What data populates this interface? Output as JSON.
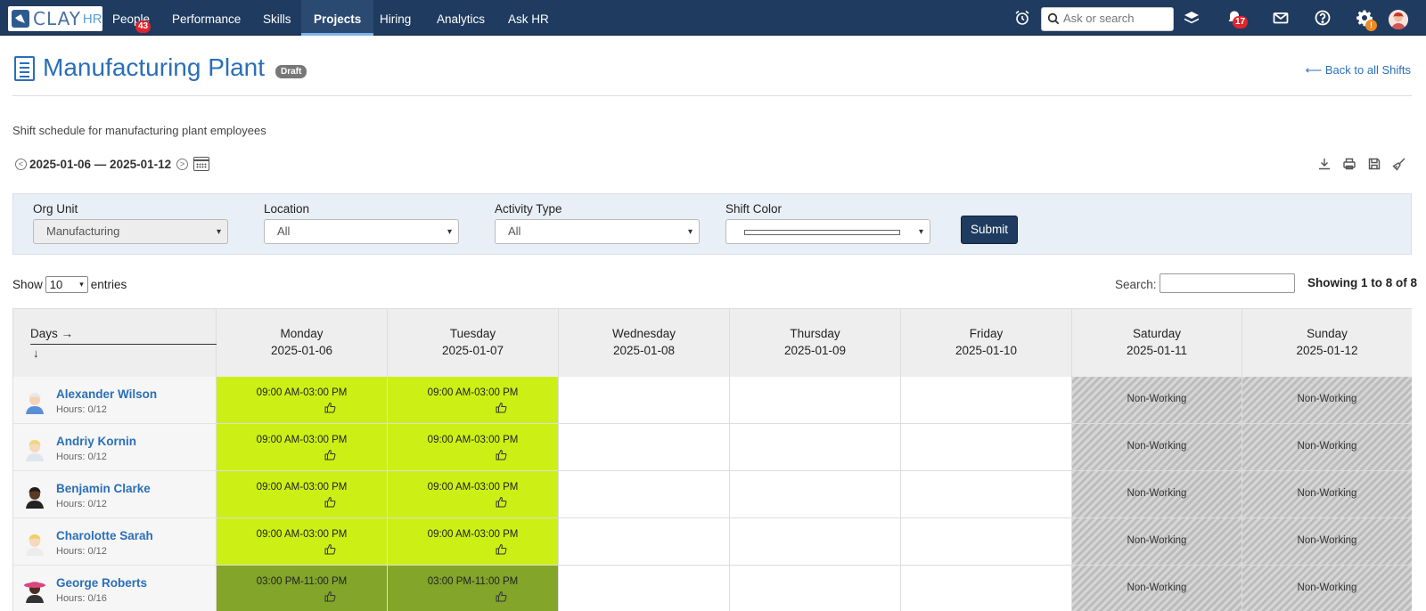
{
  "nav": {
    "logo_text": "CLAY",
    "logo_suffix": "HR",
    "items": [
      {
        "label": "People",
        "badge": "43"
      },
      {
        "label": "Performance"
      },
      {
        "label": "Skills"
      },
      {
        "label": "Projects",
        "active": true
      },
      {
        "label": "Hiring"
      },
      {
        "label": "Analytics"
      },
      {
        "label": "Ask HR"
      }
    ],
    "search_placeholder": "Ask or search",
    "notifications_badge": "17",
    "settings_badge": "!",
    "icons": [
      "alarm-clock-icon",
      "layers-icon",
      "bell-icon",
      "mail-icon",
      "help-icon",
      "gear-icon"
    ]
  },
  "header": {
    "title": "Manufacturing Plant",
    "status": "Draft",
    "back_link": "Back to all Shifts",
    "description": "Shift schedule for manufacturing plant employees",
    "date_range": "2025-01-06 — 2025-01-12"
  },
  "filters": {
    "org_unit": {
      "label": "Org Unit",
      "value": "Manufacturing"
    },
    "location": {
      "label": "Location",
      "value": "All"
    },
    "activity_type": {
      "label": "Activity Type",
      "value": "All"
    },
    "shift_color": {
      "label": "Shift Color",
      "value": ""
    },
    "submit": "Submit"
  },
  "table_controls": {
    "show_label": "Show",
    "show_value": "10",
    "entries_label": "entries",
    "search_label": "Search:",
    "showing": "Showing 1 to 8 of 8"
  },
  "schedule": {
    "days_header": "Days →",
    "down_arrow": "↓",
    "days": [
      {
        "name": "Monday",
        "date": "2025-01-06"
      },
      {
        "name": "Tuesday",
        "date": "2025-01-07"
      },
      {
        "name": "Wednesday",
        "date": "2025-01-08"
      },
      {
        "name": "Thursday",
        "date": "2025-01-09"
      },
      {
        "name": "Friday",
        "date": "2025-01-10"
      },
      {
        "name": "Saturday",
        "date": "2025-01-11"
      },
      {
        "name": "Sunday",
        "date": "2025-01-12"
      }
    ],
    "non_working_label": "Non-Working",
    "colors": {
      "day_shift": "#ccf015",
      "evening_shift": "#82a52a"
    },
    "employees": [
      {
        "name": "Alexander Wilson",
        "hours": "Hours: 0/12",
        "shifts": [
          "09:00 AM-03:00 PM",
          "09:00 AM-03:00 PM"
        ]
      },
      {
        "name": "Andriy Kornin",
        "hours": "Hours: 0/12",
        "shifts": [
          "09:00 AM-03:00 PM",
          "09:00 AM-03:00 PM"
        ]
      },
      {
        "name": "Benjamin Clarke",
        "hours": "Hours: 0/12",
        "shifts": [
          "09:00 AM-03:00 PM",
          "09:00 AM-03:00 PM"
        ]
      },
      {
        "name": "Charolotte Sarah",
        "hours": "Hours: 0/12",
        "shifts": [
          "09:00 AM-03:00 PM",
          "09:00 AM-03:00 PM"
        ]
      },
      {
        "name": "George Roberts",
        "hours": "Hours: 0/16",
        "shifts": [
          "03:00 PM-11:00 PM",
          "03:00 PM-11:00 PM"
        ]
      }
    ]
  }
}
